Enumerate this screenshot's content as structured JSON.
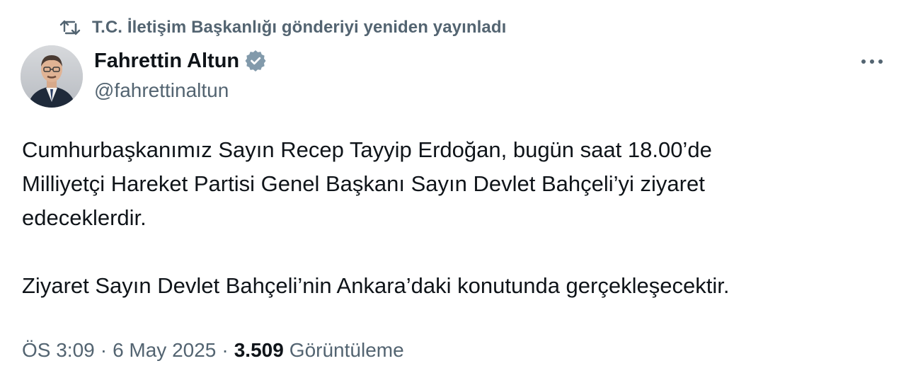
{
  "repost": {
    "icon": "repost-icon",
    "text": "T.C. İletişim Başkanlığı gönderiyi yeniden yayınladı"
  },
  "author": {
    "name": "Fahrettin Altun",
    "handle": "@fahrettinaltun",
    "verified_icon": "verified-badge-icon",
    "verified_color": "#829aab"
  },
  "more_icon": "more-options-icon",
  "tweet": {
    "line1": "Cumhurbaşkanımız Sayın Recep Tayyip Erdoğan, bugün saat 18.00’de",
    "line2": "Milliyetçi Hareket Partisi Genel Başkanı Sayın Devlet Bahçeli’yi ziyaret",
    "line3": "edeceklerdir.",
    "line4": "Ziyaret Sayın Devlet Bahçeli’nin Ankara’daki konutunda gerçekleşecektir."
  },
  "meta": {
    "time": "ÖS 3:09",
    "separator": "·",
    "date": "6 May 2025",
    "views_count": "3.509",
    "views_label": "Görüntüleme"
  },
  "colors": {
    "text": "#0f1419",
    "secondary": "#536471",
    "background": "#ffffff"
  }
}
